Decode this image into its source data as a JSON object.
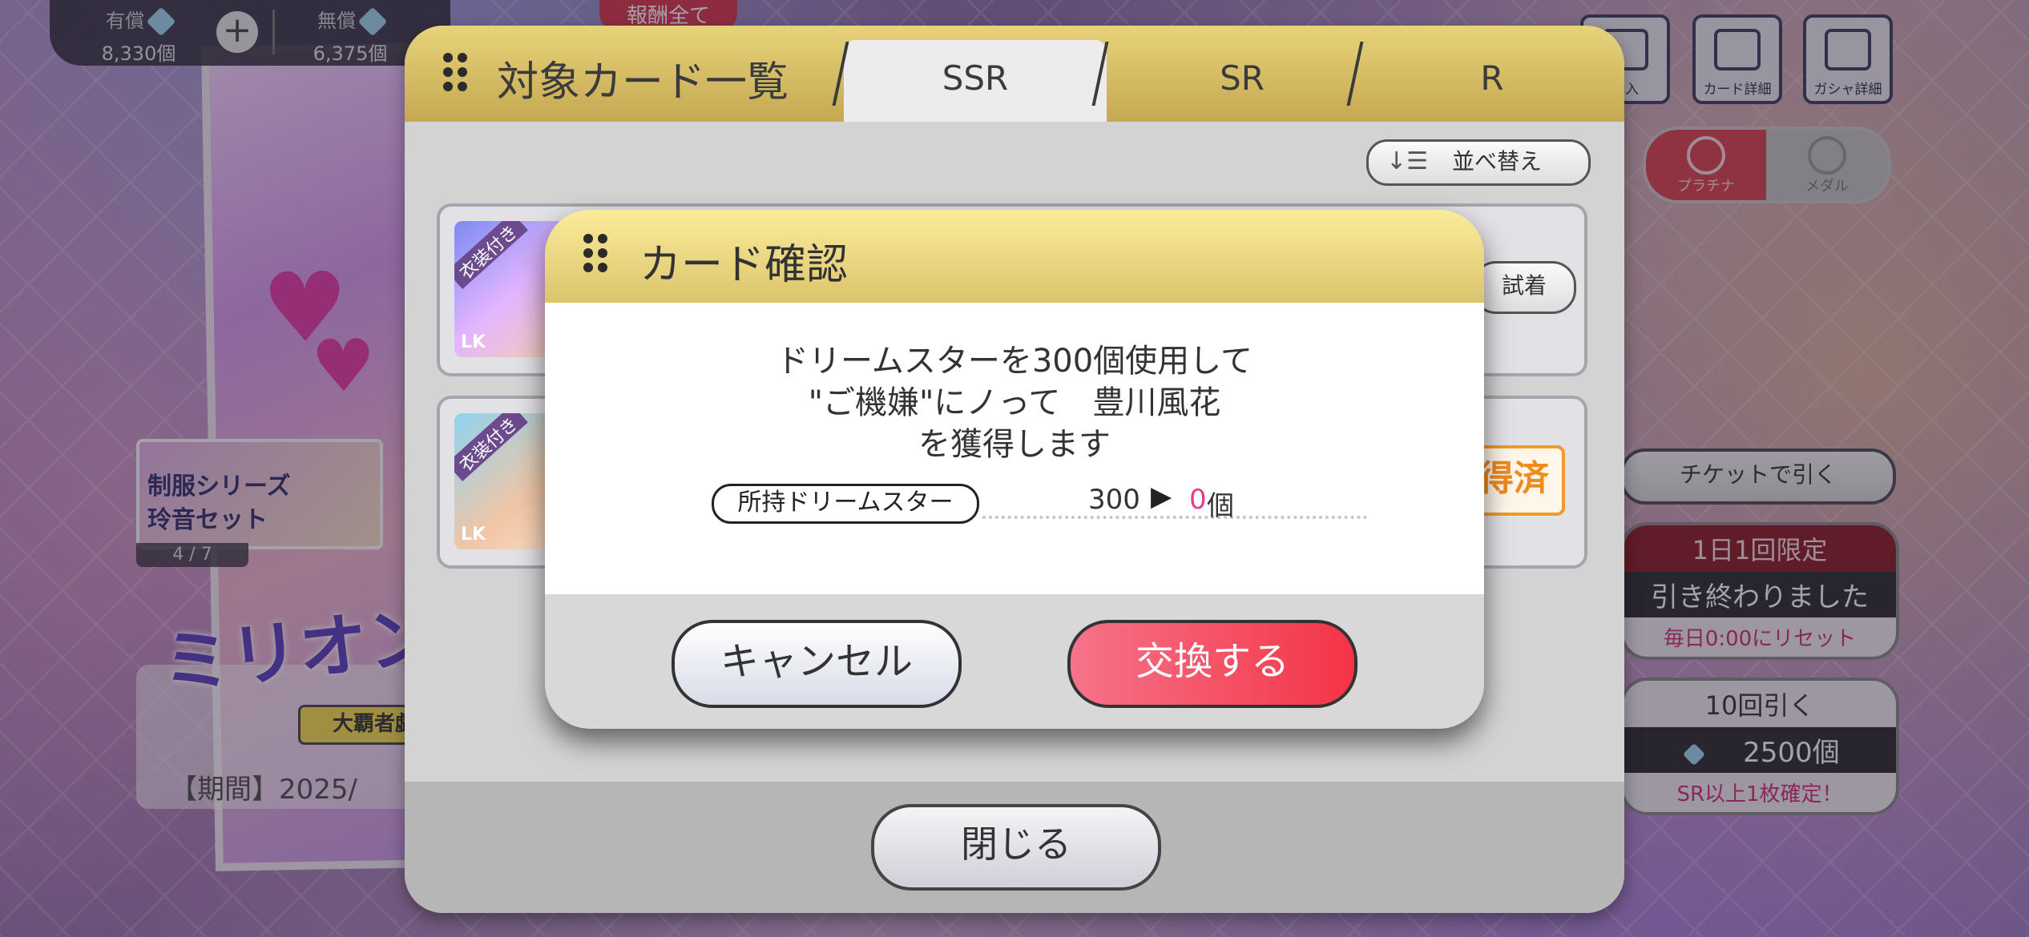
{
  "currency": {
    "paid_label": "有償",
    "paid_value": "8,330個",
    "free_label": "無償",
    "free_value": "6,375個"
  },
  "top_badge": "報酬全て",
  "event": {
    "uniform_set_line1": "制服シリーズ",
    "uniform_set_line2": "玲音セット",
    "page_indicator": "4 / 7",
    "title_text": "ミリオン",
    "sub_ribbon": "大覇者戯！",
    "period_text": "【期間】2025/"
  },
  "right_panel": {
    "buy_label": "購入",
    "card_detail_label": "カード詳細",
    "gacha_detail_label": "ガシャ詳細",
    "toggle_platinum": "プラチナ",
    "toggle_medal": "メダル",
    "ticket_button": "チケットで引く",
    "daily_title": "1日1回限定",
    "daily_status": "引き終わりました",
    "daily_reset": "毎日0:00にリセット",
    "ten_pull_title": "10回引く",
    "ten_pull_cost": "2500個",
    "ten_pull_note": "SR以上1枚確定！"
  },
  "list_window": {
    "title": "対象カード一覧",
    "tabs": [
      "SSR",
      "SR",
      "R"
    ],
    "active_tab": "SSR",
    "sort_label": "並べ替え",
    "card_ribbon": "衣装付き",
    "card_rank": "LK",
    "tryon_label": "試着",
    "acquired_label": "得済",
    "close_label": "閉じる"
  },
  "dialog": {
    "title": "カード確認",
    "line1": "ドリームスターを300個使用して",
    "line2": "\"ご機嫌\"にノって　豊川風花",
    "line3": "を獲得します",
    "possession_label": "所持ドリームスター",
    "count_before": "300",
    "count_arrow": "▶",
    "count_after": "0",
    "count_unit": "個",
    "cancel_label": "キャンセル",
    "confirm_label": "交換する"
  },
  "colors": {
    "header_gold": "#c5a852",
    "confirm_red": "#f43446",
    "accent_pink": "#e63a8a",
    "daily_red": "#8b1a24"
  }
}
